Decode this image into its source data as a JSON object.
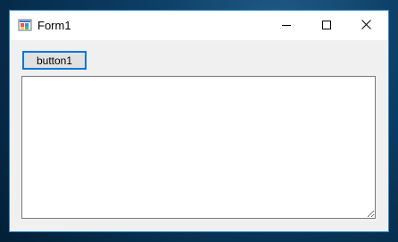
{
  "window": {
    "title": "Form1",
    "app_icon": "winforms-app-icon"
  },
  "caption_buttons": {
    "minimize": "minimize-icon",
    "maximize": "maximize-icon",
    "close": "close-icon"
  },
  "form": {
    "button1_label": "button1",
    "textbox_value": ""
  },
  "colors": {
    "window_border": "#2c8bd0",
    "button_focus_border": "#0078d7",
    "form_background": "#f0f0f0"
  }
}
